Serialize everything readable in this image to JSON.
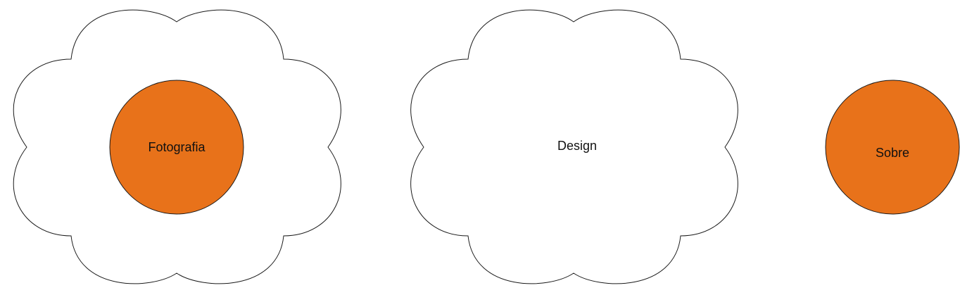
{
  "colors": {
    "accent": "#e8721a",
    "outline": "#1a1a1a",
    "background": "#ffffff",
    "text": "#111111"
  },
  "nav": {
    "fotografia": {
      "label": "Fotografia",
      "shape": "flower-with-orange-center"
    },
    "design": {
      "label": "Design",
      "shape": "flower"
    },
    "sobre": {
      "label": "Sobre",
      "shape": "orange-circle"
    }
  }
}
